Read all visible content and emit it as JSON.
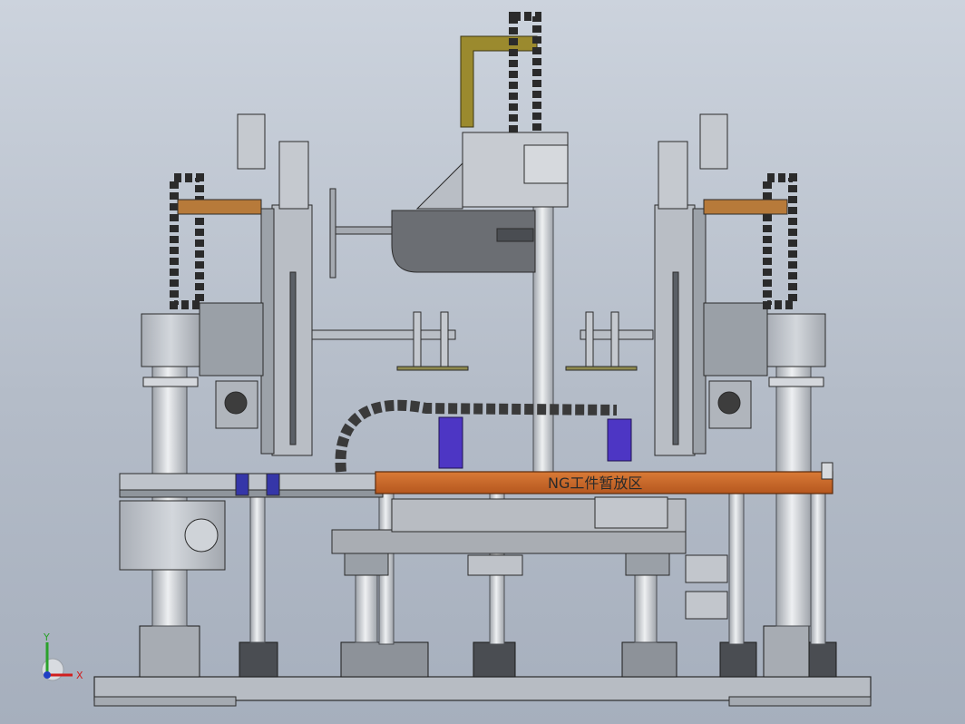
{
  "plate_label": "NG工件暂放区",
  "triad": {
    "x_label": "X",
    "y_label": "Y"
  },
  "colors": {
    "background_top": "#ccd3dd",
    "background_bottom": "#a6afbd",
    "orange_plate": "#c8692a",
    "purple_block": "#4d36c4",
    "olive_bracket": "#9b8a2e",
    "bronze_arm": "#b77a3a",
    "steel": "#c9cdd3",
    "dark_steel": "#3a3a3a"
  }
}
